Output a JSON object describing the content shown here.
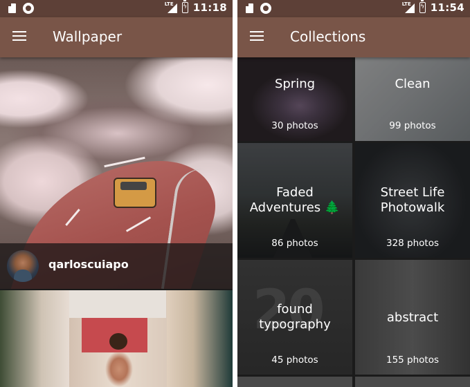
{
  "left_screen": {
    "status_bar": {
      "time": "11:18",
      "network": "LTE"
    },
    "app_bar": {
      "title": "Wallpaper"
    },
    "feed": [
      {
        "username": "qarloscuiapo"
      }
    ]
  },
  "right_screen": {
    "status_bar": {
      "time": "11:54",
      "network": "LTE"
    },
    "app_bar": {
      "title": "Collections"
    },
    "collections": [
      {
        "title": "Spring",
        "count": "30 photos"
      },
      {
        "title": "Clean",
        "count": "99 photos"
      },
      {
        "title": "Faded Adventures 🌲",
        "count": "86 photos"
      },
      {
        "title": "Street Life Photowalk",
        "count": "328 photos"
      },
      {
        "title": "found typography",
        "count": "45 photos"
      },
      {
        "title": "abstract",
        "count": "155 photos"
      }
    ]
  },
  "icons": {
    "menu": "hamburger-menu-icon",
    "sd_card": "sd-card-icon",
    "sync": "circle-icon",
    "signal": "signal-icon",
    "battery": "battery-charging-icon"
  },
  "colors": {
    "status_bar": "#5d4037",
    "app_bar": "#795548",
    "text_on_primary": "#ffffff"
  }
}
